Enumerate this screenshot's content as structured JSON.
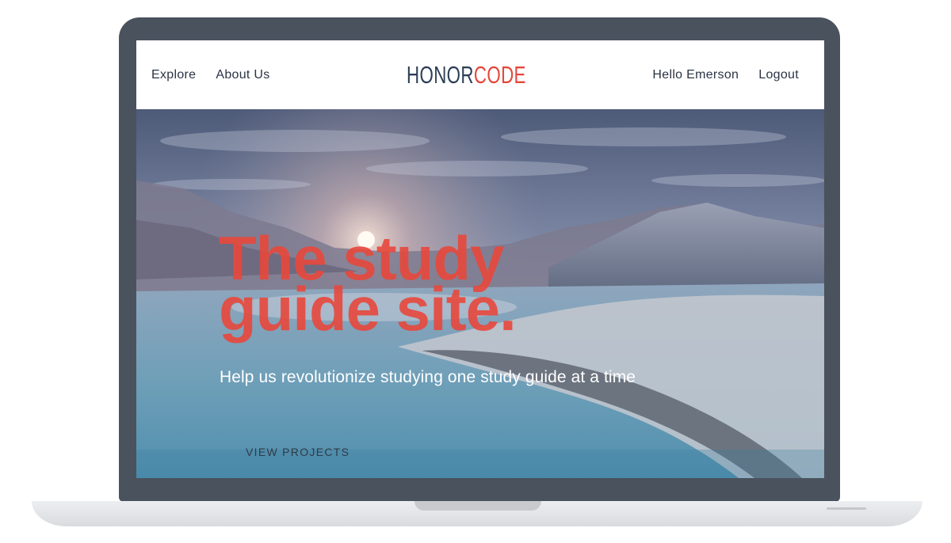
{
  "nav": {
    "left_links": [
      "Explore",
      "About Us"
    ],
    "right_links": [
      "Hello Emerson",
      "Logout"
    ]
  },
  "logo": {
    "part1": "HONOR",
    "part2": "CODE",
    "colors": {
      "part1": "#2c3e57",
      "part2": "#e4473b"
    }
  },
  "hero": {
    "headline_line1": "The study",
    "headline_line2": "guide site.",
    "subheading": "Help us revolutionize studying one study guide at a time",
    "cta_label": "VIEW PROJECTS",
    "background": "sunset over snowy mountains and icy river",
    "headline_color": "#e8483c"
  }
}
